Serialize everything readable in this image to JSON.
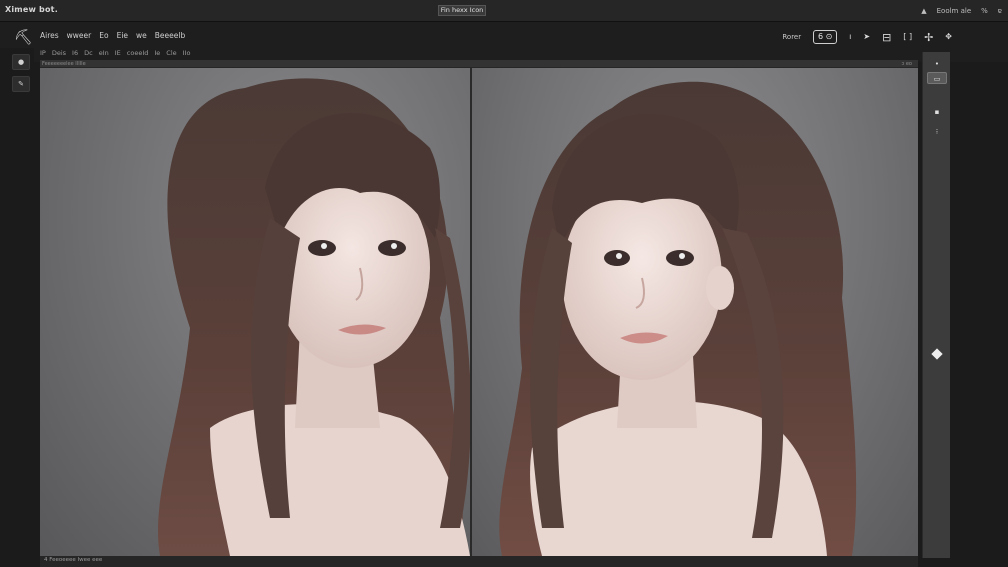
{
  "titlebar": {
    "app_name": "Ximew bot.",
    "doc_title": "Fin hexx Icon",
    "right_items": [
      {
        "icon": "arrow-up-icon",
        "label": "▲"
      },
      {
        "icon": "",
        "label": "Eoolm ale"
      },
      {
        "icon": "",
        "label": "%"
      },
      {
        "icon": "",
        "label": "ɐ"
      }
    ]
  },
  "options_bar": {
    "tool_glyph": "⛏",
    "row1": [
      "Aires",
      "wweer",
      "Eo",
      "Eie",
      "we",
      "Beeeelb"
    ],
    "row2": [
      "IP",
      "Deis",
      "I6",
      "Dc",
      "eIn",
      "IE",
      "coeeId",
      "Ie",
      "Cle",
      "IIo"
    ],
    "zoom_label": "Rorer",
    "zoom_value": "6 ⊙",
    "right_icons": [
      {
        "name": "tick-icon",
        "glyph": "ı"
      },
      {
        "name": "arrow-cursor-icon",
        "glyph": "➤"
      },
      {
        "name": "layers-icon",
        "glyph": "⊟"
      },
      {
        "name": "bracket-icon",
        "glyph": "[ ]"
      },
      {
        "name": "pin-icon",
        "glyph": "✢"
      },
      {
        "name": "move-icon",
        "glyph": "✥"
      }
    ]
  },
  "left_tools": [
    {
      "name": "brush-tool",
      "glyph": "●"
    },
    {
      "name": "pen-tool",
      "glyph": "✎"
    }
  ],
  "document": {
    "tab_label": "Feeeeeeelee IIIIIe",
    "zoom_label": "ɔ eo",
    "status_text": "4 Feeoeeee  Iwee eee"
  },
  "right_strip": {
    "tools": [
      {
        "name": "dot-tool",
        "glyph": "•",
        "active": false
      },
      {
        "name": "select-tool",
        "glyph": "▭",
        "active": true
      },
      {
        "name": "nav-tool",
        "glyph": "▪",
        "active": false
      },
      {
        "name": "info-tool",
        "glyph": "⁝",
        "active": false
      }
    ]
  }
}
